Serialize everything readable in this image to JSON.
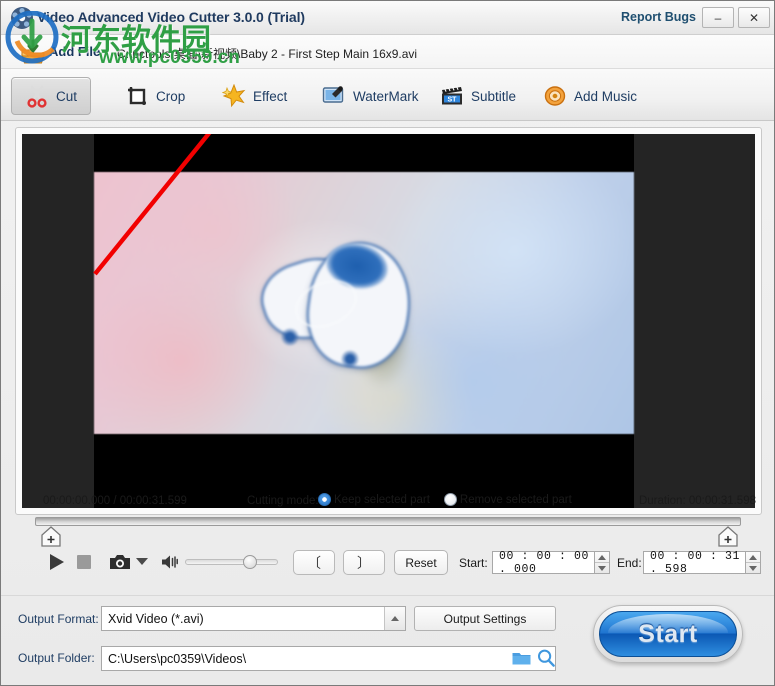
{
  "window": {
    "title": "Video Advanced Video Cutter 3.0.0 (Trial)",
    "report_bugs": "Report Bugs",
    "minimize": "–",
    "close": "✕",
    "app_icon": "film-reel-icon"
  },
  "watermark": {
    "line1": "河东软件园",
    "line2": "www.pc0359.cn",
    "color": "#2f9f45",
    "logo": "download-arrow-logo"
  },
  "addfile": {
    "label": "Add File",
    "path": "C:\\pctools\\桌面\\新视频\\Baby 2 - First Step Main 16x9.avi",
    "icon": "add-file-icon"
  },
  "tabs": [
    {
      "label": "Cut",
      "icon": "scissors-icon",
      "active": true
    },
    {
      "label": "Crop",
      "icon": "crop-icon",
      "active": false
    },
    {
      "label": "Effect",
      "icon": "star-burst-icon",
      "active": false
    },
    {
      "label": "WaterMark",
      "icon": "watermark-icon",
      "active": false
    },
    {
      "label": "Subtitle",
      "icon": "clapboard-st-icon",
      "active": false
    },
    {
      "label": "Add Music",
      "icon": "speaker-icon",
      "active": false
    }
  ],
  "preview": {
    "annotation": "red-arrow-annotation",
    "description": "baby shoes on pastel background"
  },
  "info": {
    "position_total": "00:00:00.000 / 00:00:31.599",
    "cutting_mode_label": "Cutting mode:",
    "mode_keep": "Keep selected part",
    "mode_remove": "Remove selected part",
    "selected_mode": "keep",
    "duration": "Duration: 00:00:31.598"
  },
  "controls": {
    "play": "play-button",
    "stop": "stop-button",
    "snapshot": "camera-button",
    "snapshot_menu": "camera-dropdown",
    "volume": "volume-icon",
    "volume_value": 63,
    "mark_in": "〔",
    "mark_out": "〕",
    "reset": "Reset",
    "start_label": "Start:",
    "start_value": "00 : 00 : 00 . 000",
    "end_label": "End:",
    "end_value": "00 : 00 : 31 . 598"
  },
  "output": {
    "format_label": "Output Format:",
    "format_value": "Xvid Video (*.avi)",
    "settings_button": "Output Settings",
    "folder_label": "Output Folder:",
    "folder_value": "C:\\Users\\pc0359\\Videos\\",
    "browse_icon": "folder-icon",
    "search_icon": "magnifier-icon",
    "start_button": "Start",
    "accent_blue": "#1f74d0"
  }
}
